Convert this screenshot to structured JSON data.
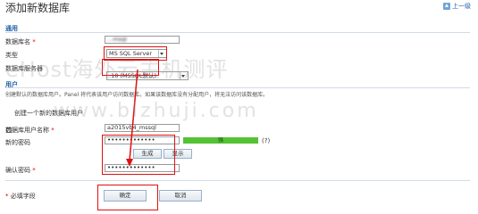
{
  "page": {
    "title": "添加新数据库",
    "back_label": "上一级"
  },
  "general": {
    "heading": "通用",
    "db_name_label": "数据库名",
    "db_name_value": "...msql",
    "type_label": "类型",
    "type_value": "MS SQL Server",
    "server_label": "数据库服务器",
    "server_value": ".18 (MSSQL默认)"
  },
  "user": {
    "heading": "用户",
    "description": "创建默认的数据库用户。Panel 将代表该用户访问数据库。如果该数据库没有分配用户，将无法访问该数据库。",
    "create_user_label": "创建一个新的数据库用户",
    "username_label": "数据库用户名称",
    "username_value": "a2015vb4_mssql",
    "password_label": "新的密码",
    "password_value": "•••••••••••••",
    "strength_label": "强",
    "help_mark": "(?)",
    "generate_label": "生成",
    "show_label": "显示",
    "confirm_label": "确认密码",
    "confirm_value": "•••••••••••••"
  },
  "footer": {
    "required_note": "必填字段",
    "ok_label": "确定",
    "cancel_label": "取消"
  },
  "watermark": {
    "line1": "eHost海外云主机测评",
    "line2": "www.blzhuji.com"
  },
  "colors": {
    "highlight": "#e01010",
    "accent": "#1f5fa8",
    "strength": "#54c234"
  }
}
